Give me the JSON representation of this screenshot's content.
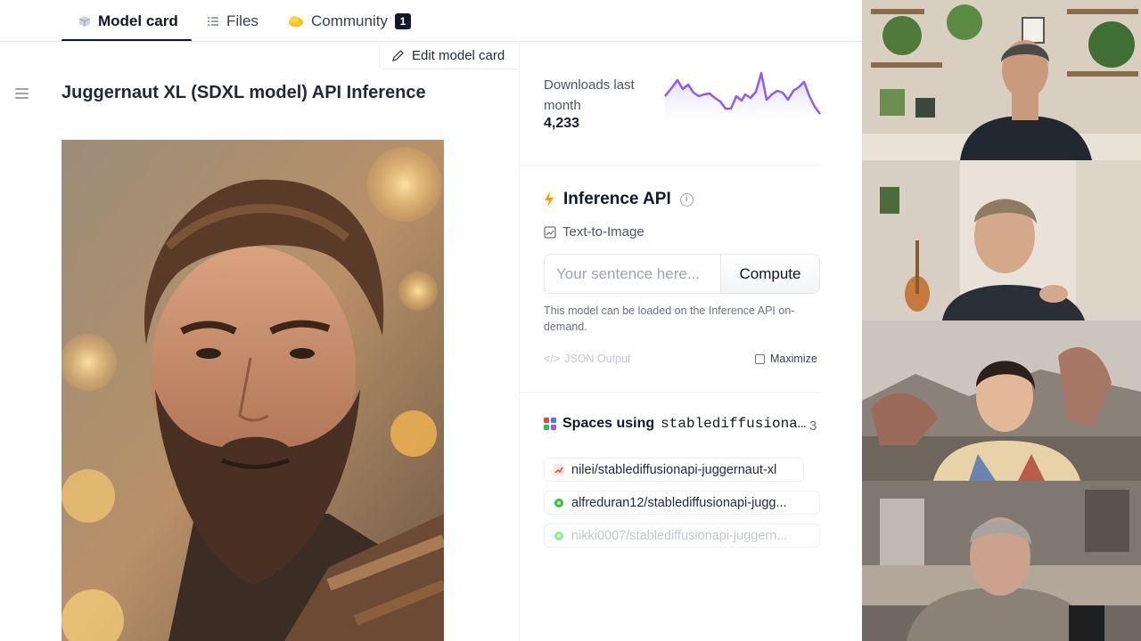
{
  "tabs": [
    {
      "label": "Model card",
      "icon": "cube-icon",
      "active": true
    },
    {
      "label": "Files",
      "icon": "file-list-icon",
      "active": false
    },
    {
      "label": "Community",
      "icon": "community-icon",
      "active": false,
      "badge": "1"
    }
  ],
  "edit_model_card": "Edit model card",
  "model": {
    "title": "Juggernaut XL (SDXL model) API Inference"
  },
  "downloads": {
    "label": "Downloads last month",
    "count": "4,233"
  },
  "inference": {
    "heading": "Inference API",
    "task": "Text-to-Image",
    "placeholder": "Your sentence here...",
    "compute_label": "Compute",
    "note": "This model can be loaded on the Inference API on-demand.",
    "json_output": "JSON Output",
    "maximize": "Maximize"
  },
  "spaces": {
    "heading": "Spaces using",
    "repo": "stablediffusionapi/juggernaut-xl",
    "count": "3",
    "items": [
      {
        "name": "nilei/stablediffusionapi-juggernaut-xl",
        "icon_color": "#ef4444"
      },
      {
        "name": "alfreduran12/stablediffusionapi-jugg...",
        "icon_color": "#22c55e"
      },
      {
        "name": "nikki0007/stablediffusionapi-juggern...",
        "icon_color": "#86efac"
      }
    ]
  },
  "colors": {
    "accent_orange": "#f59e0b",
    "sparkline": "#8b5cf6"
  }
}
